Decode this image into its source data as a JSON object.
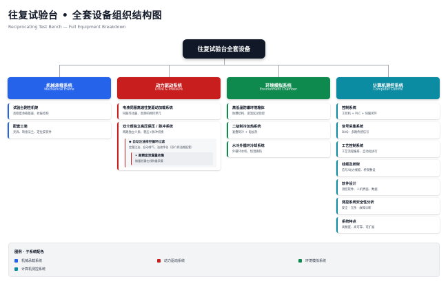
{
  "header": {
    "title": "往复试验台 • 全套设备组织结构图",
    "subtitle": "Reciprocating Test Bench — Full Equipment Breakdown"
  },
  "root": {
    "label": "往复试验台全套设备"
  },
  "colors": {
    "mechanical": "#2563eb",
    "power": "#c81e1e",
    "environment": "#0f8a4f",
    "computer": "#0c8ca3",
    "root": "#111827"
  },
  "columns": [
    {
      "cn": "机械承载系统",
      "en": "Mechanical Frame",
      "cards": [
        {
          "title": "试验台刚性机架",
          "desc": "高刚度承载基座、抗振结构"
        },
        {
          "title": "配套工装",
          "desc": "夹具、转接法兰、定位安装件"
        }
      ]
    },
    {
      "cn": "动力驱动系统",
      "en": "Drive & Pressure",
      "cards": [
        {
          "title": "电液伺服高速往复驱动加载系统",
          "desc": "伺服作动器、高频响阀控单元"
        },
        {
          "title": "双介质独立高压保压 / 脉冲系统",
          "desc": "两路独立介质、稳压+脉冲切换",
          "sub": {
            "title": "◆ 自动注油排空循环过滤",
            "desc": "定量注油、自动排气、油液净化（双介质油路配套）",
            "subsub": {
              "title": "• 高精度泄漏量收集",
              "desc": "微量泄漏在线称重采集"
            }
          }
        }
      ]
    },
    {
      "cn": "环境模拟系统",
      "en": "Environment Chamber",
      "cards": [
        {
          "title": "高低温防爆环境箱体",
          "desc": "防爆结构、宽温区试验腔"
        },
        {
          "title": "二级制冷加热系统",
          "desc": "复叠制冷 + 电加热"
        },
        {
          "title": "水冷外循环冷却系统",
          "desc": "外循环水机、恒温换热"
        }
      ]
    },
    {
      "cn": "计算机测控系统",
      "en": "Computer Control",
      "cards": [
        {
          "title": "控制系统",
          "desc": "工控机 + PLC + 伺服闭环"
        },
        {
          "title": "信号采集系统",
          "desc": "DAQ · 多路传感信号"
        },
        {
          "title": "工艺控制系统",
          "desc": "工艺流程编排、自动化执行"
        },
        {
          "title": "线缆及桥架",
          "desc": "信号/动力线缆、桥架敷设"
        },
        {
          "title": "软件设计",
          "desc": "测控软件、人机界面、数据"
        },
        {
          "title": "测控系统安全性分析",
          "desc": "安全 · 冗余 · 故障诊断"
        },
        {
          "title": "系统特点",
          "desc": "高精度、高可靠、可扩展"
        }
      ]
    }
  ],
  "legend": {
    "title": "图例 · 子系统配色",
    "items": [
      "机械承载系统",
      "动力驱动系统",
      "环境模拟系统",
      "计算机测控系统"
    ]
  }
}
